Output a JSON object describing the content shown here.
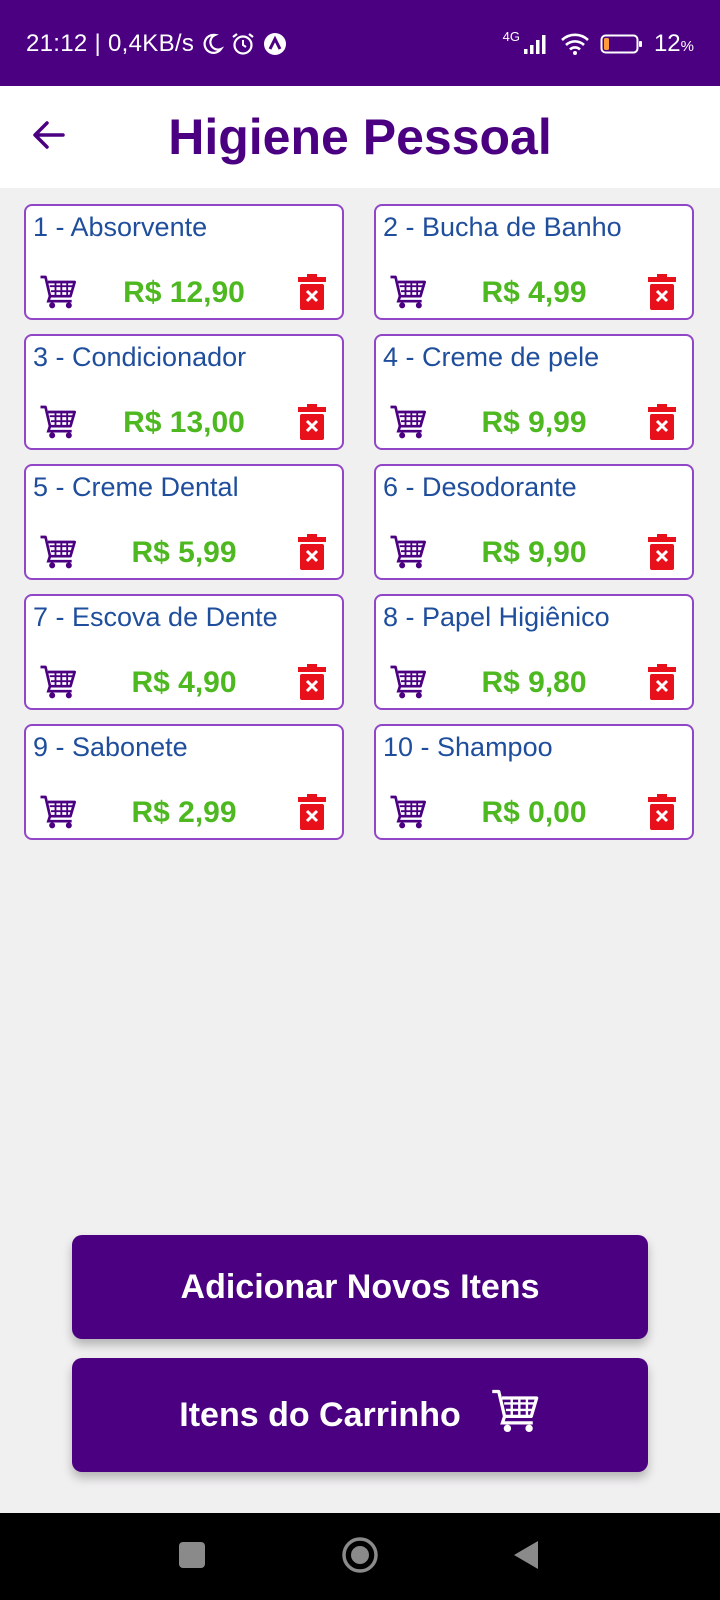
{
  "status_bar": {
    "time_speed": "21:12 | 0,4KB/s",
    "network": "4G",
    "battery": "12",
    "battery_unit": "%"
  },
  "header": {
    "title": "Higiene Pessoal"
  },
  "products": [
    {
      "label": "1 - Absorvente",
      "price": "R$ 12,90"
    },
    {
      "label": "2 - Bucha de Banho",
      "price": "R$ 4,99"
    },
    {
      "label": "3 - Condicionador",
      "price": "R$ 13,00"
    },
    {
      "label": "4 - Creme de pele",
      "price": "R$ 9,99"
    },
    {
      "label": "5 - Creme Dental",
      "price": "R$ 5,99"
    },
    {
      "label": "6 - Desodorante",
      "price": "R$ 9,90"
    },
    {
      "label": "7 - Escova de Dente",
      "price": "R$ 4,90"
    },
    {
      "label": "8 - Papel Higiênico",
      "price": "R$ 9,80"
    },
    {
      "label": "9 - Sabonete",
      "price": "R$ 2,99"
    },
    {
      "label": "10 - Shampoo",
      "price": "R$ 0,00"
    }
  ],
  "buttons": {
    "add_new": "Adicionar Novos Itens",
    "cart_items": "Itens do Carrinho"
  },
  "icons": {
    "back": "arrow-left-icon",
    "cart": "cart-icon",
    "delete": "trash-delete-icon",
    "nav_recents": "square-icon",
    "nav_home": "circle-icon",
    "nav_back": "triangle-back-icon"
  },
  "colors": {
    "primary": "#4b0082",
    "price": "#4db81f",
    "delete": "#e8101a",
    "label": "#1f4e9c",
    "card_border": "#9146c8"
  }
}
